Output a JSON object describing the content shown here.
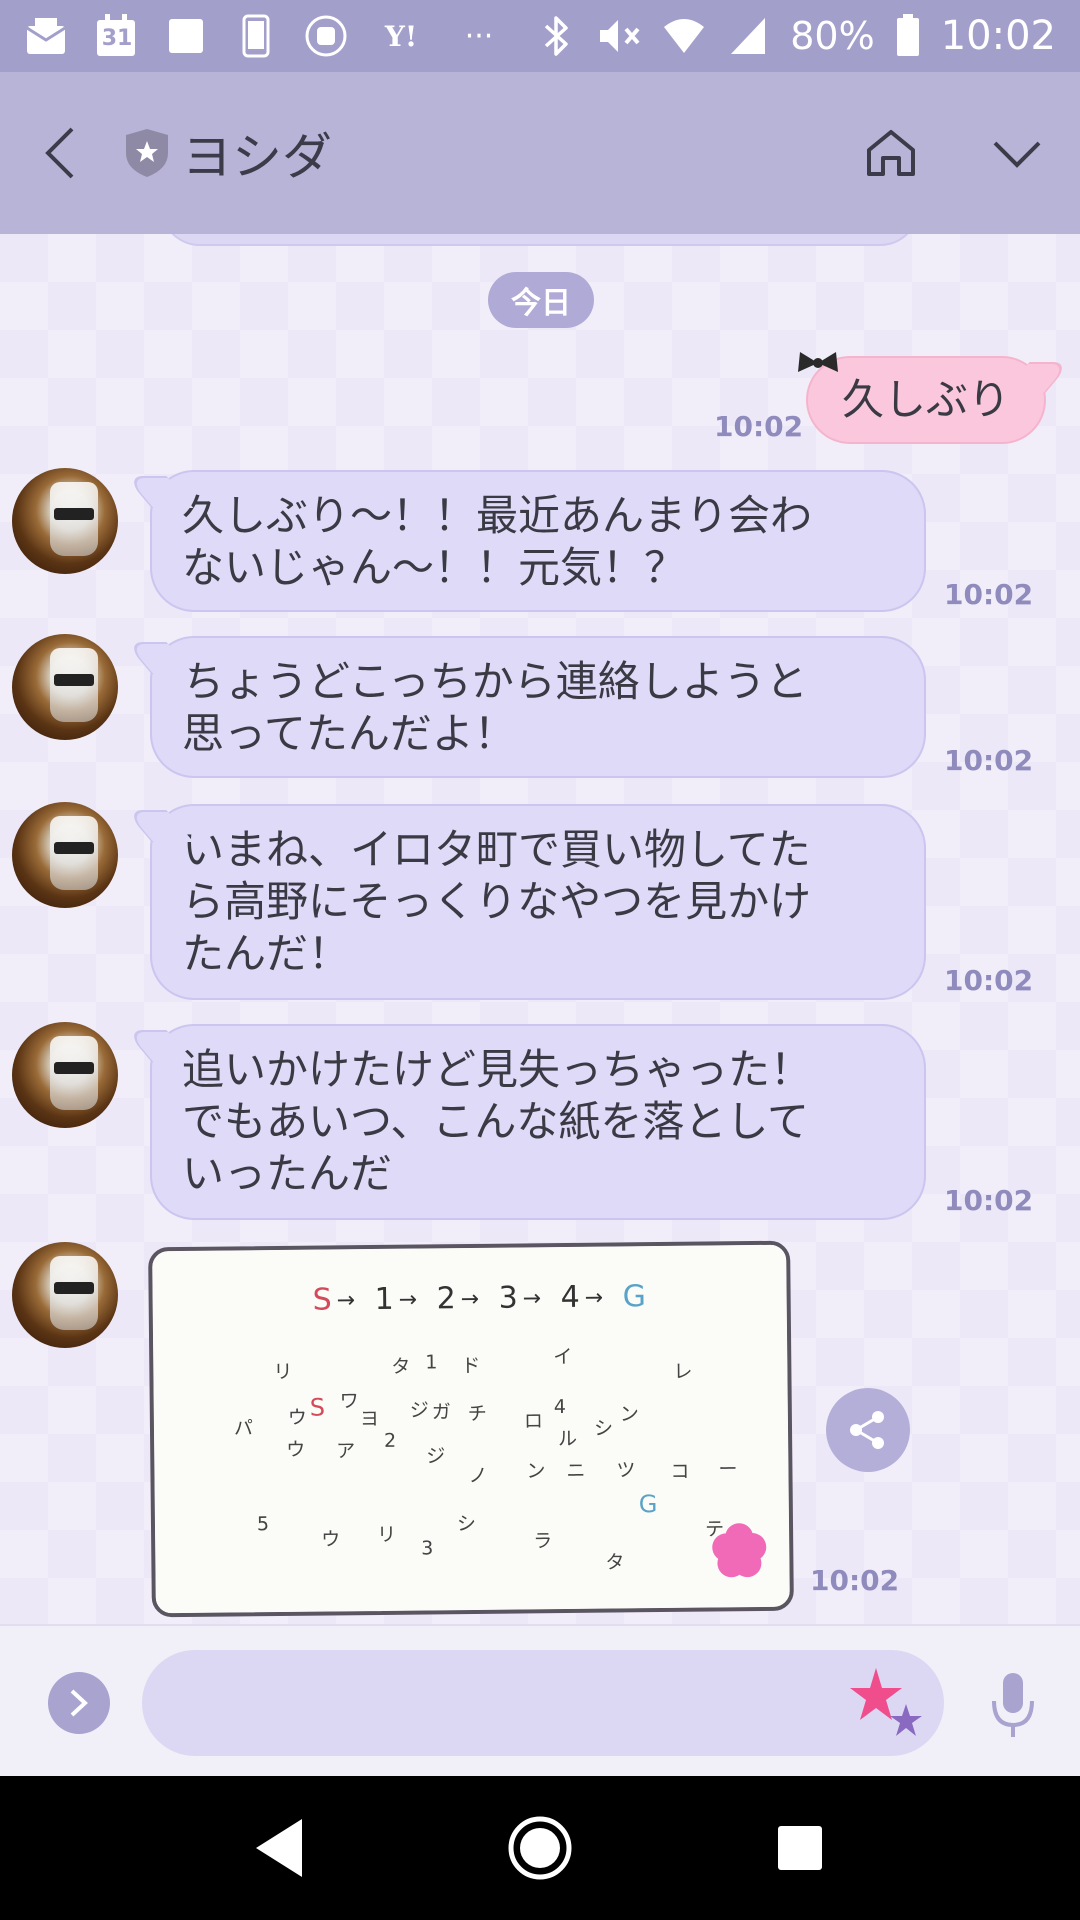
{
  "status_bar": {
    "battery": "80%",
    "time": "10:02",
    "calendar_day": "31",
    "yahoo": "Y!",
    "more": "···",
    "icons": [
      "mail-icon",
      "calendar-icon",
      "square-icon",
      "phone-icon",
      "cup-icon",
      "yahoo-icon",
      "more-icon",
      "bluetooth-icon",
      "mute-icon",
      "wifi-icon",
      "signal-icon",
      "battery-icon"
    ]
  },
  "header": {
    "name": "ヨシダ"
  },
  "chat": {
    "date_label": "今日",
    "messages": [
      {
        "side": "out",
        "text": "久しぶり",
        "time": "10:02"
      },
      {
        "side": "in",
        "lines": [
          "久しぶり〜！！最近あんまり会わ",
          "ないじゃん〜！！元気！？"
        ],
        "time": "10:02"
      },
      {
        "side": "in",
        "lines": [
          "ちょうどこっちから連絡しようと",
          "思ってたんだよ！"
        ],
        "time": "10:02"
      },
      {
        "side": "in",
        "lines": [
          "いまね、イロタ町で買い物してた",
          "ら高野にそっくりなやつを見かけ",
          "たんだ！"
        ],
        "time": "10:02"
      },
      {
        "side": "in",
        "lines": [
          "追いかけたけど見失っちゃった！",
          "でもあいつ、こんな紙を落として",
          "いったんだ"
        ],
        "time": "10:02"
      },
      {
        "side": "in",
        "type": "image",
        "time": "10:02"
      }
    ],
    "image_note": {
      "route": [
        "S",
        "1",
        "2",
        "3",
        "4",
        "G"
      ],
      "letters": [
        "リ",
        "タ",
        "1",
        "ド",
        "イ",
        "レ",
        "S",
        "ワ",
        "ウ",
        "パ",
        "ヨ",
        "ジ",
        "ガ",
        "チ",
        "ロ",
        "4",
        "ン",
        "ウ",
        "ア",
        "2",
        "ジ",
        "ル",
        "シ",
        "ノ",
        "ン",
        "ニ",
        "ツ",
        "コ",
        "ー",
        "5",
        "シ",
        "G",
        "テ",
        "ウ",
        "リ",
        "3",
        "ラ",
        "タ"
      ]
    }
  },
  "input": {
    "placeholder": ""
  },
  "colors": {
    "header_bg": "#b8b4d8",
    "status_bg": "#a39fcb",
    "bubble_in": "#dedaf7",
    "bubble_out": "#fbc7dc",
    "timestamp": "#8f8bbd"
  }
}
